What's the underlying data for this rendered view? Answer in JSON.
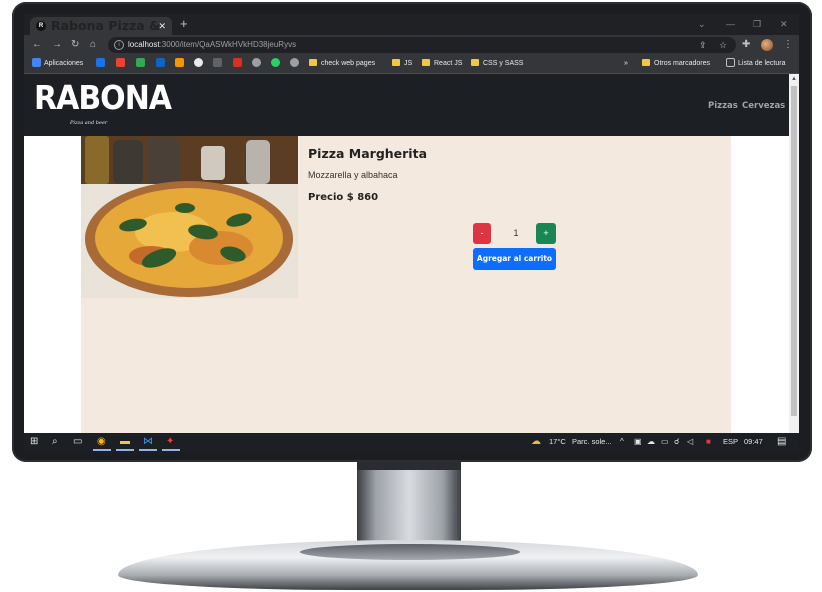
{
  "browser": {
    "tab_title": "Rabona Pizza & Beer",
    "tab_favicon": "R",
    "url_host": "localhost",
    "url_path": ":3000/item/QaASWkHVkHD38jeuRyvs",
    "bookmarks": [
      {
        "label": "Aplicaciones",
        "icon": "apps-grid-icon",
        "color": "#4285f4"
      },
      {
        "label": "",
        "icon": "outlook-icon",
        "color": "#1a73e8"
      },
      {
        "label": "",
        "icon": "gmail-icon",
        "color": "#ea4335"
      },
      {
        "label": "",
        "icon": "drive-icon",
        "color": "#34a853"
      },
      {
        "label": "",
        "icon": "linkedin-icon",
        "color": "#0a66c2"
      },
      {
        "label": "",
        "icon": "bookmark-orange-icon",
        "color": "#f29900"
      },
      {
        "label": "",
        "icon": "github-icon",
        "color": "#e8eaed"
      },
      {
        "label": "",
        "icon": "bookmark-dark-icon",
        "color": "#5f6368"
      },
      {
        "label": "",
        "icon": "bookmark-red-icon",
        "color": "#d93025"
      },
      {
        "label": "",
        "icon": "globe-icon",
        "color": "#9aa0a6"
      },
      {
        "label": "",
        "icon": "whatsapp-icon",
        "color": "#25d366"
      },
      {
        "label": "",
        "icon": "globe-icon",
        "color": "#9aa0a6"
      }
    ],
    "bookmark_folders": [
      "check web pages",
      "JS",
      "React JS",
      "CSS y SASS"
    ],
    "other_bookmarks": "Otros marcadores",
    "reading_list": "Lista de lectura",
    "overflow": "»"
  },
  "site": {
    "logo_main": "RABONA",
    "logo_sub": "Pizza and beer",
    "nav_links": [
      "Pizzas",
      "Cervezas"
    ]
  },
  "product": {
    "name": "Pizza Margherita",
    "description": "Mozzarella y albahaca",
    "price_label": "Precio $ 860",
    "quantity": "1",
    "minus_label": "-",
    "plus_label": "+",
    "add_to_cart_label": "Agregar al carrito",
    "colors": {
      "minus": "#dc3545",
      "plus": "#198754",
      "add": "#0d6efd",
      "card_bg": "#f3e9df"
    }
  },
  "taskbar": {
    "weather_temp": "17°C",
    "weather_text": "Parc. sole...",
    "language": "ESP",
    "time": "09:47"
  }
}
